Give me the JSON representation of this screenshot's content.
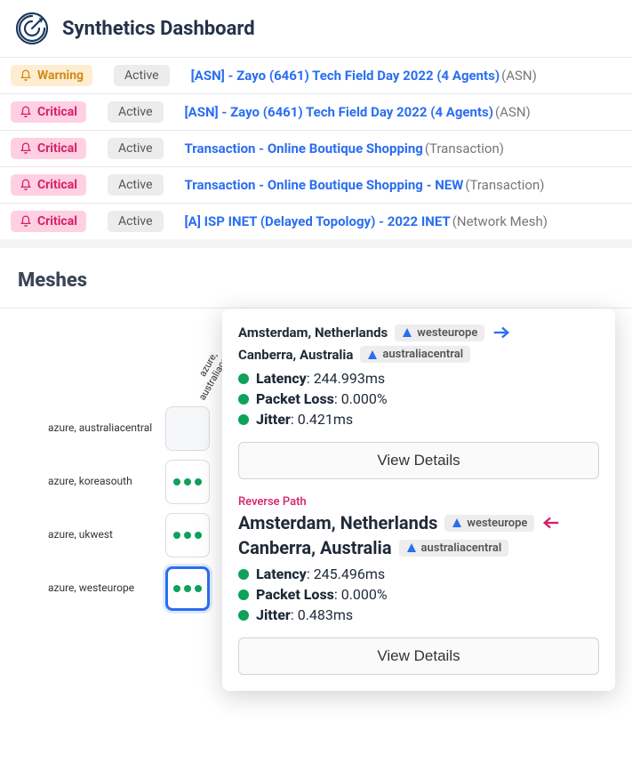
{
  "header": {
    "title": "Synthetics Dashboard"
  },
  "alerts": [
    {
      "severity": "Warning",
      "state": "Active",
      "title": "[ASN] - Zayo (6461) Tech Field Day 2022 (4 Agents)",
      "paren": "(ASN)"
    },
    {
      "severity": "Critical",
      "state": "Active",
      "title": "[ASN] - Zayo (6461) Tech Field Day 2022 (4 Agents)",
      "paren": "(ASN)"
    },
    {
      "severity": "Critical",
      "state": "Active",
      "title": "Transaction - Online Boutique Shopping",
      "paren": "(Transaction)"
    },
    {
      "severity": "Critical",
      "state": "Active",
      "title": "Transaction - Online Boutique Shopping - NEW",
      "paren": "(Transaction)"
    },
    {
      "severity": "Critical",
      "state": "Active",
      "title": "[A] ISP INET (Delayed Topology) - 2022 INET",
      "paren": "(Network Mesh)"
    }
  ],
  "meshes": {
    "heading": "Meshes",
    "col_headers": [
      "azure, australiacentral",
      "",
      "",
      ""
    ],
    "rows": [
      {
        "label": "azure, australiacentral"
      },
      {
        "label": "azure, koreasouth"
      },
      {
        "label": "azure, ukwest"
      },
      {
        "label": "azure, westeurope"
      }
    ]
  },
  "popover": {
    "forward": {
      "from": {
        "city": "Amsterdam, Netherlands",
        "region": "westeurope"
      },
      "to": {
        "city": "Canberra, Australia",
        "region": "australiacentral"
      },
      "latency_label": "Latency",
      "latency_value": ": 244.993ms",
      "packet_label": "Packet Loss",
      "packet_value": ": 0.000%",
      "jitter_label": "Jitter",
      "jitter_value": ": 0.421ms",
      "button": "View Details"
    },
    "reverse_label": "Reverse Path",
    "reverse": {
      "from": {
        "city": "Amsterdam, Netherlands",
        "region": "westeurope"
      },
      "to": {
        "city": "Canberra, Australia",
        "region": "australiacentral"
      },
      "latency_label": "Latency",
      "latency_value": ": 245.496ms",
      "packet_label": "Packet Loss",
      "packet_value": ": 0.000%",
      "jitter_label": "Jitter",
      "jitter_value": ": 0.483ms",
      "button": "View Details"
    }
  }
}
